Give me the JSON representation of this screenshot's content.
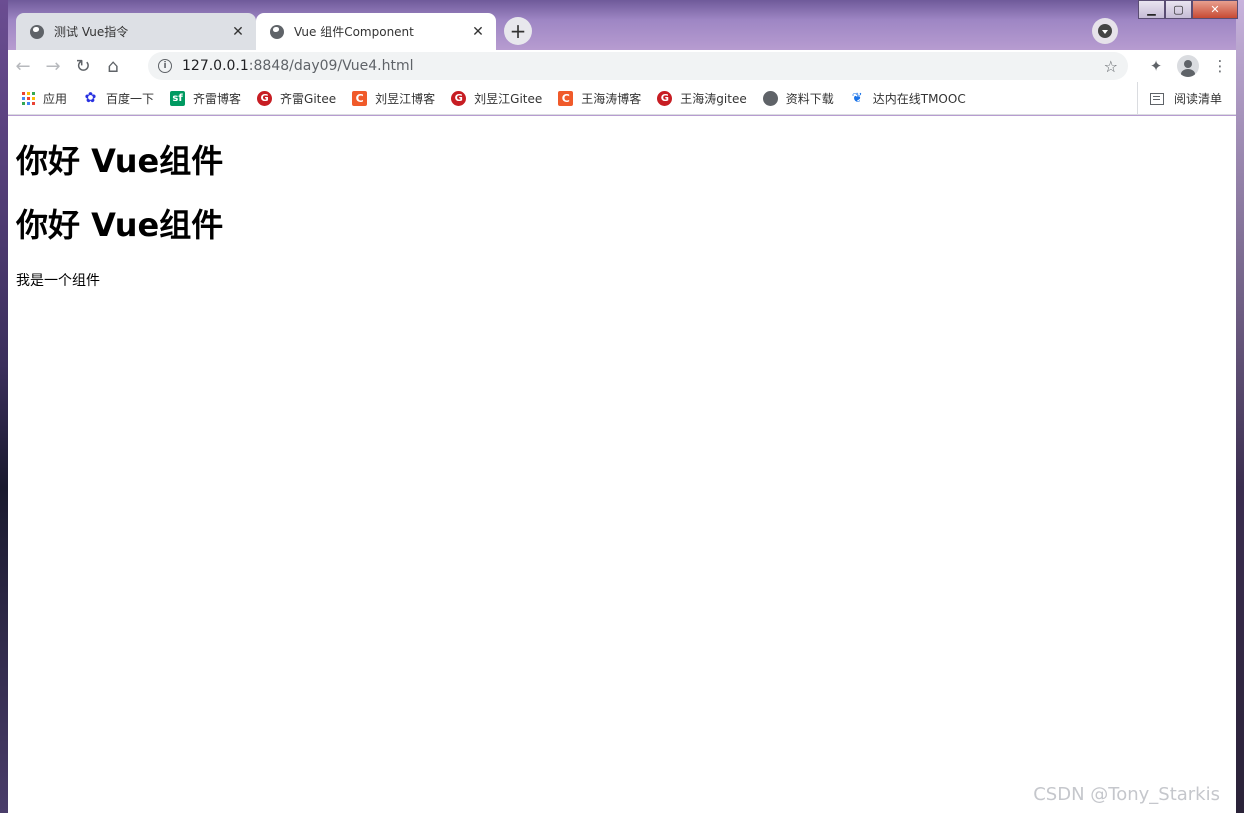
{
  "window": {
    "minimize_label": "▁",
    "maximize_label": "▢",
    "close_label": "✕"
  },
  "tabs": [
    {
      "title": "测试 Vue指令",
      "close": "✕"
    },
    {
      "title": "Vue 组件Component",
      "close": "✕"
    }
  ],
  "newtab_label": "+",
  "toolbar": {
    "back": "←",
    "forward": "→",
    "reload": "↻",
    "home": "⌂",
    "info": "i",
    "url_host": "127.0.0.1",
    "url_path": ":8848/day09/Vue4.html",
    "star": "☆",
    "extensions": "✦",
    "menu": "⋮"
  },
  "bookmarks": [
    {
      "label": "应用",
      "icon": "apps-icon"
    },
    {
      "label": "百度一下",
      "icon": "baidu-icon",
      "glyph": "✿"
    },
    {
      "label": "齐雷博客",
      "icon": "sf-icon",
      "glyph": "sf"
    },
    {
      "label": "齐雷Gitee",
      "icon": "gitee-icon",
      "glyph": "G"
    },
    {
      "label": "刘昱江博客",
      "icon": "csdn-icon",
      "glyph": "C"
    },
    {
      "label": "刘昱江Gitee",
      "icon": "gitee-icon",
      "glyph": "G"
    },
    {
      "label": "王海涛博客",
      "icon": "csdn-icon",
      "glyph": "C"
    },
    {
      "label": "王海涛gitee",
      "icon": "gitee-icon",
      "glyph": "G"
    },
    {
      "label": "资料下载",
      "icon": "globe-icon",
      "glyph": ""
    },
    {
      "label": "达内在线TMOOC",
      "icon": "tarena-icon",
      "glyph": "❦"
    }
  ],
  "reading_list": "阅读清单",
  "page": {
    "heading1": "你好 Vue组件",
    "heading2": "你好 Vue组件",
    "paragraph": "我是一个组件"
  },
  "watermark": "CSDN @Tony_Starkis",
  "colors": {
    "apps": [
      "#ea4335",
      "#fbbc04",
      "#34a853",
      "#4285f4",
      "#ea4335",
      "#fbbc04",
      "#34a853",
      "#4285f4",
      "#ea4335"
    ]
  }
}
